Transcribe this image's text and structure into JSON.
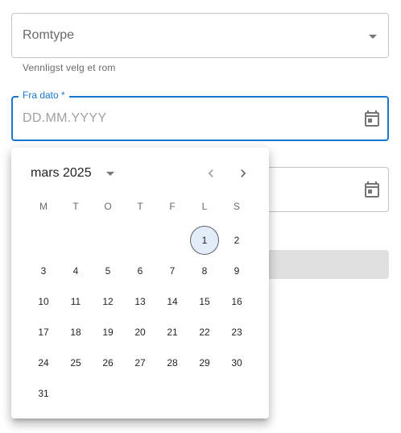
{
  "room_select": {
    "value": "Romtype",
    "helper_text": "Vennligst velg et rom"
  },
  "from_date": {
    "label": "Fra dato *",
    "placeholder": "DD.MM.YYYY"
  },
  "calendar": {
    "month_label": "mars 2025",
    "weekdays": [
      "M",
      "T",
      "O",
      "T",
      "F",
      "L",
      "S"
    ],
    "leading_blanks": 5,
    "days": [
      "1",
      "2",
      "3",
      "4",
      "5",
      "6",
      "7",
      "8",
      "9",
      "10",
      "11",
      "12",
      "13",
      "14",
      "15",
      "16",
      "17",
      "18",
      "19",
      "20",
      "21",
      "22",
      "23",
      "24",
      "25",
      "26",
      "27",
      "28",
      "29",
      "30",
      "31"
    ],
    "today": "1"
  },
  "icons": {
    "select_arrow": "arrow-drop-down-icon",
    "calendar": "calendar-icon",
    "month_dropdown": "arrow-drop-down-icon",
    "prev": "chevron-left-icon",
    "next": "chevron-right-icon"
  },
  "colors": {
    "accent": "#1976d2",
    "today_bg": "#e3edf9",
    "disabled_button": "#e0e0e0"
  }
}
